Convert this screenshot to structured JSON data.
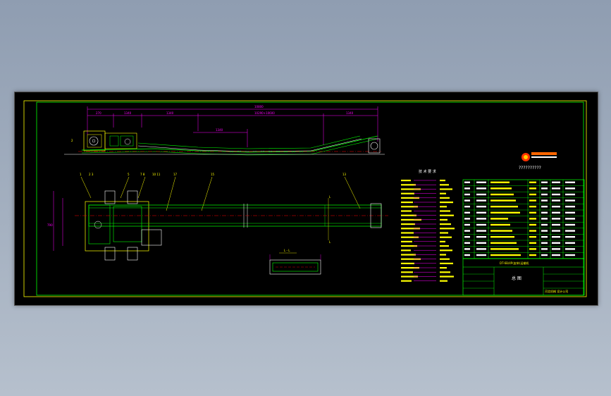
{
  "drawing": {
    "tech_title": "技 术 要 求",
    "overall_dimension": "10800",
    "dimensions_top": [
      "270",
      "1340",
      "1340",
      "10290+10600",
      "1340"
    ],
    "sub_dimension": "1340",
    "logo_text": "??????????",
    "title_block_name": "总  图",
    "title_block_model": "DT-6B/4P(皮带)运输机",
    "title_block_footer": "河北机械  设计公司",
    "company_colors": {
      "frame": "#00ff00",
      "dimension": "#ff00ff",
      "text": "#ffff00",
      "centerline": "#ff0000",
      "outline": "#ffffff"
    }
  }
}
